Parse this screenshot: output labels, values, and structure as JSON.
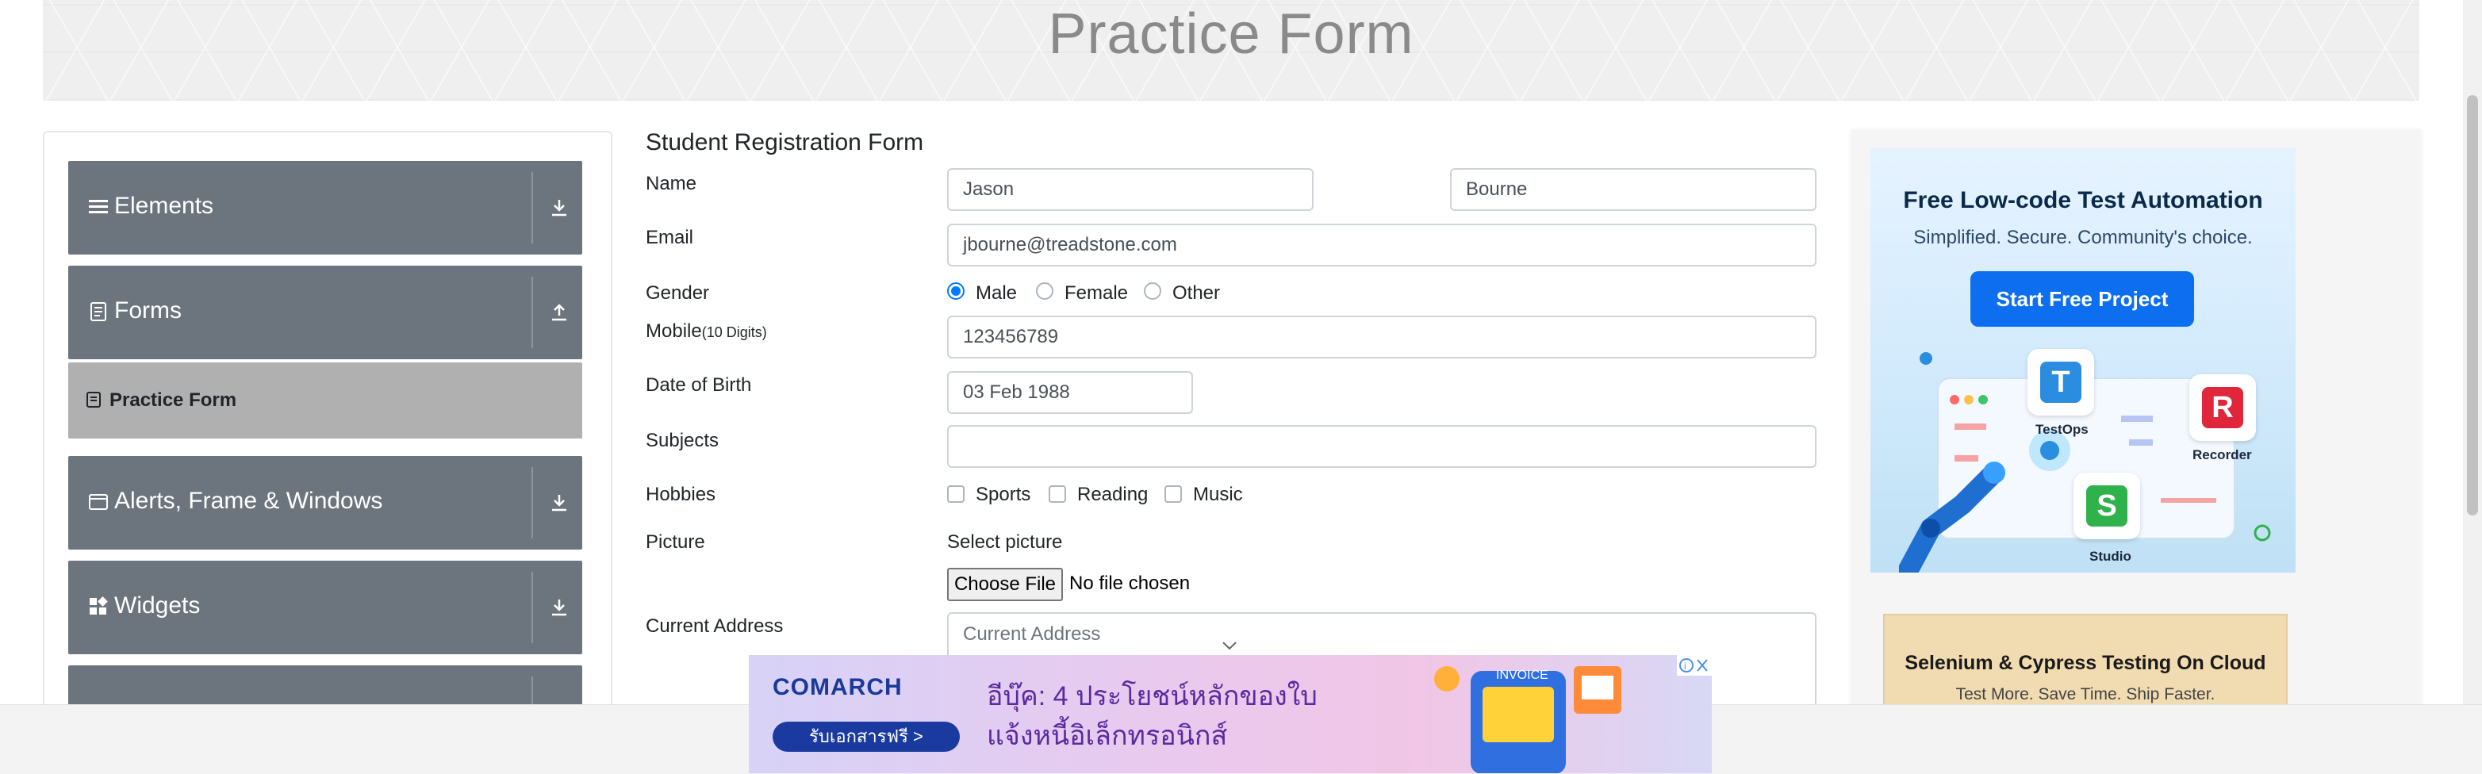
{
  "header": {
    "title": "Practice Form"
  },
  "sidebar": {
    "groups": [
      {
        "label": "Elements",
        "icon": "hamburger-icon",
        "arrow": "download-arrow-icon"
      },
      {
        "label": "Forms",
        "icon": "document-icon",
        "arrow": "upload-arrow-icon"
      },
      {
        "label": "Alerts, Frame & Windows",
        "icon": "window-icon",
        "arrow": "download-arrow-icon"
      },
      {
        "label": "Widgets",
        "icon": "widgets-icon",
        "arrow": "download-arrow-icon"
      }
    ],
    "active_item": {
      "label": "Practice Form",
      "icon": "form-icon"
    }
  },
  "form": {
    "title": "Student Registration Form",
    "name": {
      "label": "Name",
      "first": "Jason",
      "last": "Bourne"
    },
    "email": {
      "label": "Email",
      "value": "jbourne@treadstone.com"
    },
    "gender": {
      "label": "Gender",
      "options": [
        "Male",
        "Female",
        "Other"
      ],
      "selected": "Male"
    },
    "mobile": {
      "label": "Mobile",
      "hint": "(10 Digits)",
      "value": "123456789"
    },
    "dob": {
      "label": "Date of Birth",
      "value": "03 Feb 1988"
    },
    "subjects": {
      "label": "Subjects",
      "value": ""
    },
    "hobbies": {
      "label": "Hobbies",
      "options": [
        "Sports",
        "Reading",
        "Music"
      ]
    },
    "picture": {
      "label": "Picture",
      "select_label": "Select picture",
      "button": "Choose File",
      "status": "No file chosen"
    },
    "address": {
      "label": "Current Address",
      "placeholder": "Current Address"
    }
  },
  "right_ad": {
    "title": "Free Low-code Test Automation",
    "subtitle": "Simplified. Secure. Community's choice.",
    "cta": "Start Free Project",
    "tiles": [
      {
        "letter": "T",
        "label": "TestOps",
        "color": "#2b8de0"
      },
      {
        "letter": "R",
        "label": "Recorder",
        "color": "#e0263a"
      },
      {
        "letter": "S",
        "label": "Studio",
        "color": "#2fb24b"
      }
    ],
    "secondary_title": "Selenium & Cypress Testing On Cloud",
    "secondary_subtitle": "Test More. Save Time. Ship Faster."
  },
  "bottom_ad": {
    "brand": "COMARCH",
    "button": "รับเอกสารฟรี >",
    "line1": "อีบุ๊ค: 4 ประโยชน์หลักของใบ",
    "line2": "แจ้งหนี้อิเล็กทรอนิกส์",
    "art_label": "INVOICE"
  },
  "colors": {
    "sidebar_header": "#6c757d",
    "active_item": "#b0b0b0",
    "radio_checked": "#007bff",
    "ad_cta": "#0d6ef0"
  }
}
